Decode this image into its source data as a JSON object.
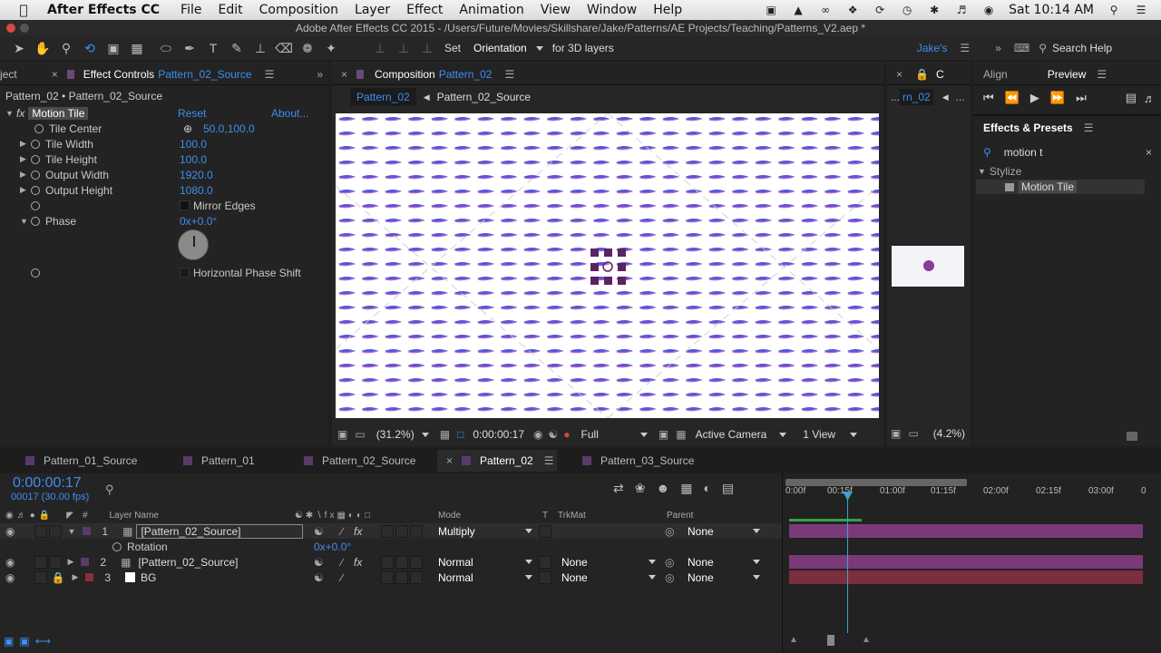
{
  "menubar": {
    "app": "After Effects CC",
    "items": [
      "File",
      "Edit",
      "Composition",
      "Layer",
      "Effect",
      "Animation",
      "View",
      "Window",
      "Help"
    ],
    "clock": "Sat 10:14 AM"
  },
  "titlebar": {
    "title": "Adobe After Effects CC 2015 - /Users/Future/Movies/Skillshare/Jake/Patterns/AE Projects/Teaching/Patterns_V2.aep *"
  },
  "toolbar": {
    "set_label": "Set",
    "orientation_label": "Orientation",
    "for3d_label": "for 3D layers",
    "workspace": "Jake's",
    "search_help": "Search Help"
  },
  "effect_controls": {
    "left_stub": "ject",
    "tab_prefix": "Effect Controls",
    "tab_target": "Pattern_02_Source",
    "breadcrumb": "Pattern_02 • Pattern_02_Source",
    "effect_name": "Motion Tile",
    "reset": "Reset",
    "about": "About...",
    "props": [
      {
        "name": "Tile Center",
        "value": "50.0,100.0"
      },
      {
        "name": "Tile Width",
        "value": "100.0"
      },
      {
        "name": "Tile Height",
        "value": "100.0"
      },
      {
        "name": "Output Width",
        "value": "1920.0"
      },
      {
        "name": "Output Height",
        "value": "1080.0"
      },
      {
        "name": "Mirror Edges",
        "value": ""
      },
      {
        "name": "Phase",
        "value": "0x+0.0°"
      },
      {
        "name": "Horizontal Phase Shift",
        "value": ""
      }
    ]
  },
  "composition": {
    "tab_prefix": "Composition",
    "tab_target": "Pattern_02",
    "nav_active": "Pattern_02",
    "nav_next": "Pattern_02_Source",
    "footer": {
      "zoom": "(31.2%)",
      "timecode": "0:00:00:17",
      "resolution": "Full",
      "camera": "Active Camera",
      "view": "1 View"
    }
  },
  "mini_panel": {
    "tab": "C",
    "label": "rn_02",
    "zoom": "(4.2%)"
  },
  "right": {
    "align_tab": "Align",
    "preview_tab": "Preview",
    "effects_presets": "Effects & Presets",
    "search_value": "motion t",
    "category": "Stylize",
    "result": "Motion Tile"
  },
  "timeline": {
    "tabs": [
      "Pattern_01_Source",
      "Pattern_01",
      "Pattern_02_Source",
      "Pattern_02",
      "Pattern_03_Source"
    ],
    "active_tab": "Pattern_02",
    "timecode": "0:00:00:17",
    "frames": "00017 (30.00 fps)",
    "columns": {
      "num": "#",
      "layer_name": "Layer Name",
      "mode": "Mode",
      "t": "T",
      "trkmat": "TrkMat",
      "parent": "Parent"
    },
    "ruler": [
      "0:00f",
      "00:15f",
      "01:00f",
      "01:15f",
      "02:00f",
      "02:15f",
      "03:00f",
      "0"
    ],
    "layers": [
      {
        "num": "1",
        "name": "[Pattern_02_Source]",
        "mode": "Multiply",
        "trkmat": "",
        "parent": "None"
      },
      {
        "num": "2",
        "name": "[Pattern_02_Source]",
        "mode": "Normal",
        "trkmat": "None",
        "parent": "None"
      },
      {
        "num": "3",
        "name": "BG",
        "mode": "Normal",
        "trkmat": "None",
        "parent": "None"
      }
    ],
    "rotation_label": "Rotation",
    "rotation_value": "0x+0.0°"
  },
  "colors": {
    "accent": "#3d8ef0",
    "label_purple": "#5b3a6b",
    "bar_purple": "#7a3a7a",
    "bar_red": "#7a2e3e"
  }
}
